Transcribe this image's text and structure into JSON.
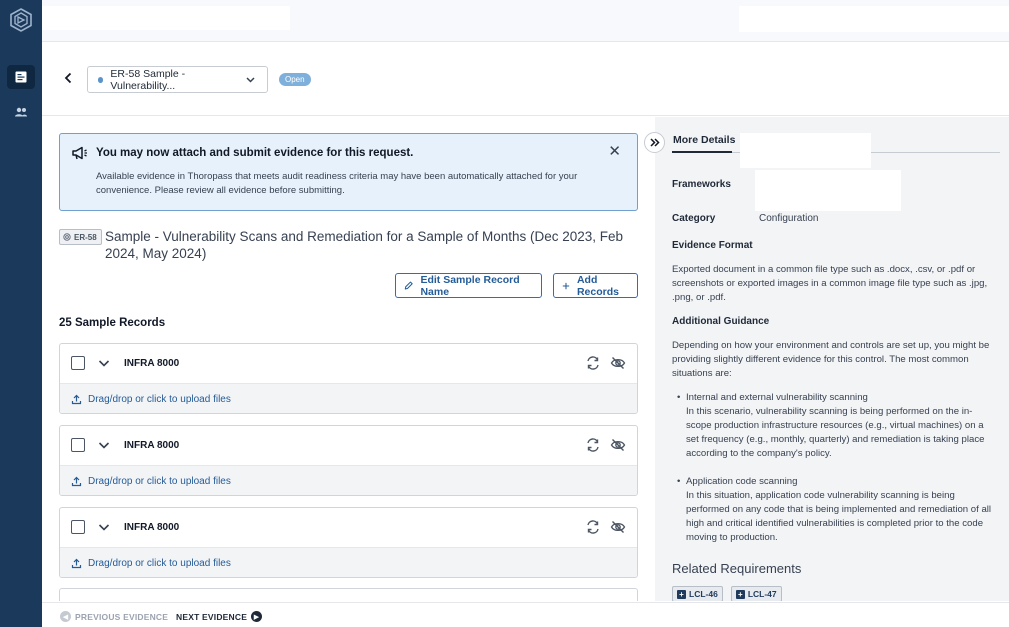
{
  "app": {
    "logo_icon": "thoropass-logo-icon",
    "nav": [
      {
        "icon": "evidence-list-icon",
        "active": true
      },
      {
        "icon": "users-icon",
        "active": false
      }
    ]
  },
  "header": {
    "request_select": "ER-58 Sample - Vulnerability...",
    "status": "Open"
  },
  "alert": {
    "title": "You may now attach and submit evidence for this request.",
    "body": "Available evidence in Thoropass that meets audit readiness criteria may have been automatically attached for your convenience. Please review all evidence before submitting.",
    "close": "✕"
  },
  "request": {
    "id": "ER-58",
    "title": "Sample - Vulnerability Scans and Remediation for a Sample of Months (Dec 2023, Feb 2024, May 2024)"
  },
  "actions": {
    "edit": "Edit Sample Record Name",
    "add": "Add Records"
  },
  "records": {
    "heading": "25 Sample Records",
    "items": [
      {
        "name": "INFRA 8000",
        "upload": "Drag/drop or click to upload files"
      },
      {
        "name": "INFRA 8000",
        "upload": "Drag/drop or click to upload files"
      },
      {
        "name": "INFRA 8000",
        "upload": "Drag/drop or click to upload files"
      }
    ]
  },
  "details": {
    "tab": "More Details",
    "frameworks_label": "Frameworks",
    "category_label": "Category",
    "category_value": "Configuration",
    "format_label": "Evidence Format",
    "format_text": "Exported document in a common file type such as .docx, .csv, or .pdf or screenshots or exported images in a common image file type such as .jpg, .png, or .pdf.",
    "guidance_label": "Additional Guidance",
    "guidance_text": "Depending on how your environment and controls are set up, you might be providing slightly different evidence for this control. The most common situations are:",
    "bullets": [
      {
        "title": "Internal and external vulnerability scanning",
        "text": "In this scenario, vulnerability scanning is being performed on the in-scope production infrastructure resources (e.g., virtual machines) on a set frequency (e.g., monthly, quarterly) and remediation is taking place according to the company's policy."
      },
      {
        "title": "Application code scanning",
        "text": "In this situation, application code vulnerability scanning is being performed on any code that is being implemented and remediation of all high and critical identified vulnerabilities is completed prior to the code moving to production."
      }
    ],
    "related_label": "Related Requirements",
    "related": [
      "LCL-46",
      "LCL-47"
    ]
  },
  "footer": {
    "prev": "PREVIOUS EVIDENCE",
    "next": "NEXT EVIDENCE"
  },
  "colors": {
    "rail": "#1b3a5b",
    "accent": "#245c98",
    "alert_bg": "#e6f1fb",
    "status_pill": "#7fb0db"
  }
}
